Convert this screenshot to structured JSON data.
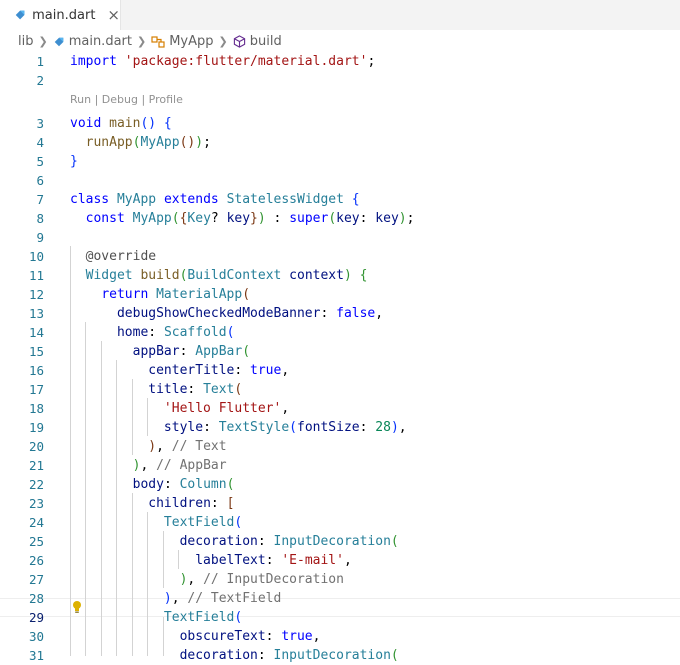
{
  "tab": {
    "label": "main.dart",
    "close": "×"
  },
  "breadcrumb": {
    "folder": "lib",
    "file": "main.dart",
    "class": "MyApp",
    "method": "build"
  },
  "codelens": "Run | Debug | Profile",
  "editor": {
    "active_line": 29,
    "lightbulb_line": 29
  },
  "lines": [
    {
      "n": "1"
    },
    {
      "n": "2"
    },
    {
      "n": "3"
    },
    {
      "n": "4"
    },
    {
      "n": "5"
    },
    {
      "n": "6"
    },
    {
      "n": "7"
    },
    {
      "n": "8"
    },
    {
      "n": "9"
    },
    {
      "n": "10"
    },
    {
      "n": "11"
    },
    {
      "n": "12"
    },
    {
      "n": "13"
    },
    {
      "n": "14"
    },
    {
      "n": "15"
    },
    {
      "n": "16"
    },
    {
      "n": "17"
    },
    {
      "n": "18"
    },
    {
      "n": "19"
    },
    {
      "n": "20"
    },
    {
      "n": "21"
    },
    {
      "n": "22"
    },
    {
      "n": "23"
    },
    {
      "n": "24"
    },
    {
      "n": "25"
    },
    {
      "n": "26"
    },
    {
      "n": "27"
    },
    {
      "n": "28"
    },
    {
      "n": "29"
    },
    {
      "n": "30"
    },
    {
      "n": "31"
    }
  ],
  "code": {
    "l1": [
      "import",
      " ",
      "'package:flutter/material.dart'",
      ";"
    ],
    "l3": [
      "void",
      " ",
      "main",
      "(",
      ")",
      " {"
    ],
    "l4": [
      "  ",
      "runApp",
      "(",
      "MyApp",
      "(",
      ")",
      ")",
      ";"
    ],
    "l5": [
      "}"
    ],
    "l7": [
      "class",
      " ",
      "MyApp",
      " ",
      "extends",
      " ",
      "StatelessWidget",
      " {"
    ],
    "l8": [
      "  ",
      "const",
      " ",
      "MyApp",
      "(",
      "{",
      "Key",
      "? ",
      "key",
      "}",
      ")",
      " : ",
      "super",
      "(",
      "key",
      ": ",
      "key",
      ")",
      ";"
    ],
    "l10": [
      "  ",
      "@override"
    ],
    "l11": [
      "  ",
      "Widget",
      " ",
      "build",
      "(",
      "BuildContext",
      " ",
      "context",
      ")",
      " {"
    ],
    "l12": [
      "    ",
      "return",
      " ",
      "MaterialApp",
      "("
    ],
    "l13": [
      "      ",
      "debugShowCheckedModeBanner",
      ": ",
      "false",
      ","
    ],
    "l14": [
      "      ",
      "home",
      ": ",
      "Scaffold",
      "("
    ],
    "l15": [
      "        ",
      "appBar",
      ": ",
      "AppBar",
      "("
    ],
    "l16": [
      "          ",
      "centerTitle",
      ": ",
      "true",
      ","
    ],
    "l17": [
      "          ",
      "title",
      ": ",
      "Text",
      "("
    ],
    "l18": [
      "            ",
      "'Hello Flutter'",
      ","
    ],
    "l19": [
      "            ",
      "style",
      ": ",
      "TextStyle",
      "(",
      "fontSize",
      ": ",
      "28",
      ")",
      ","
    ],
    "l20": [
      "          ",
      ")",
      ", ",
      "// Text"
    ],
    "l21": [
      "        ",
      ")",
      ", ",
      "// AppBar"
    ],
    "l22": [
      "        ",
      "body",
      ": ",
      "Column",
      "("
    ],
    "l23": [
      "          ",
      "children",
      ": ",
      "["
    ],
    "l24": [
      "            ",
      "TextField",
      "("
    ],
    "l25": [
      "              ",
      "decoration",
      ": ",
      "InputDecoration",
      "("
    ],
    "l26": [
      "                ",
      "labelText",
      ": ",
      "'E-mail'",
      ","
    ],
    "l27": [
      "              ",
      ")",
      ", ",
      "// InputDecoration"
    ],
    "l28": [
      "            ",
      ")",
      ", ",
      "// TextField"
    ],
    "l29": [
      "            ",
      "TextField",
      "("
    ],
    "l30": [
      "              ",
      "obscureText",
      ": ",
      "true",
      ","
    ],
    "l31": [
      "              ",
      "decoration",
      ": ",
      "InputDecoration",
      "("
    ]
  }
}
